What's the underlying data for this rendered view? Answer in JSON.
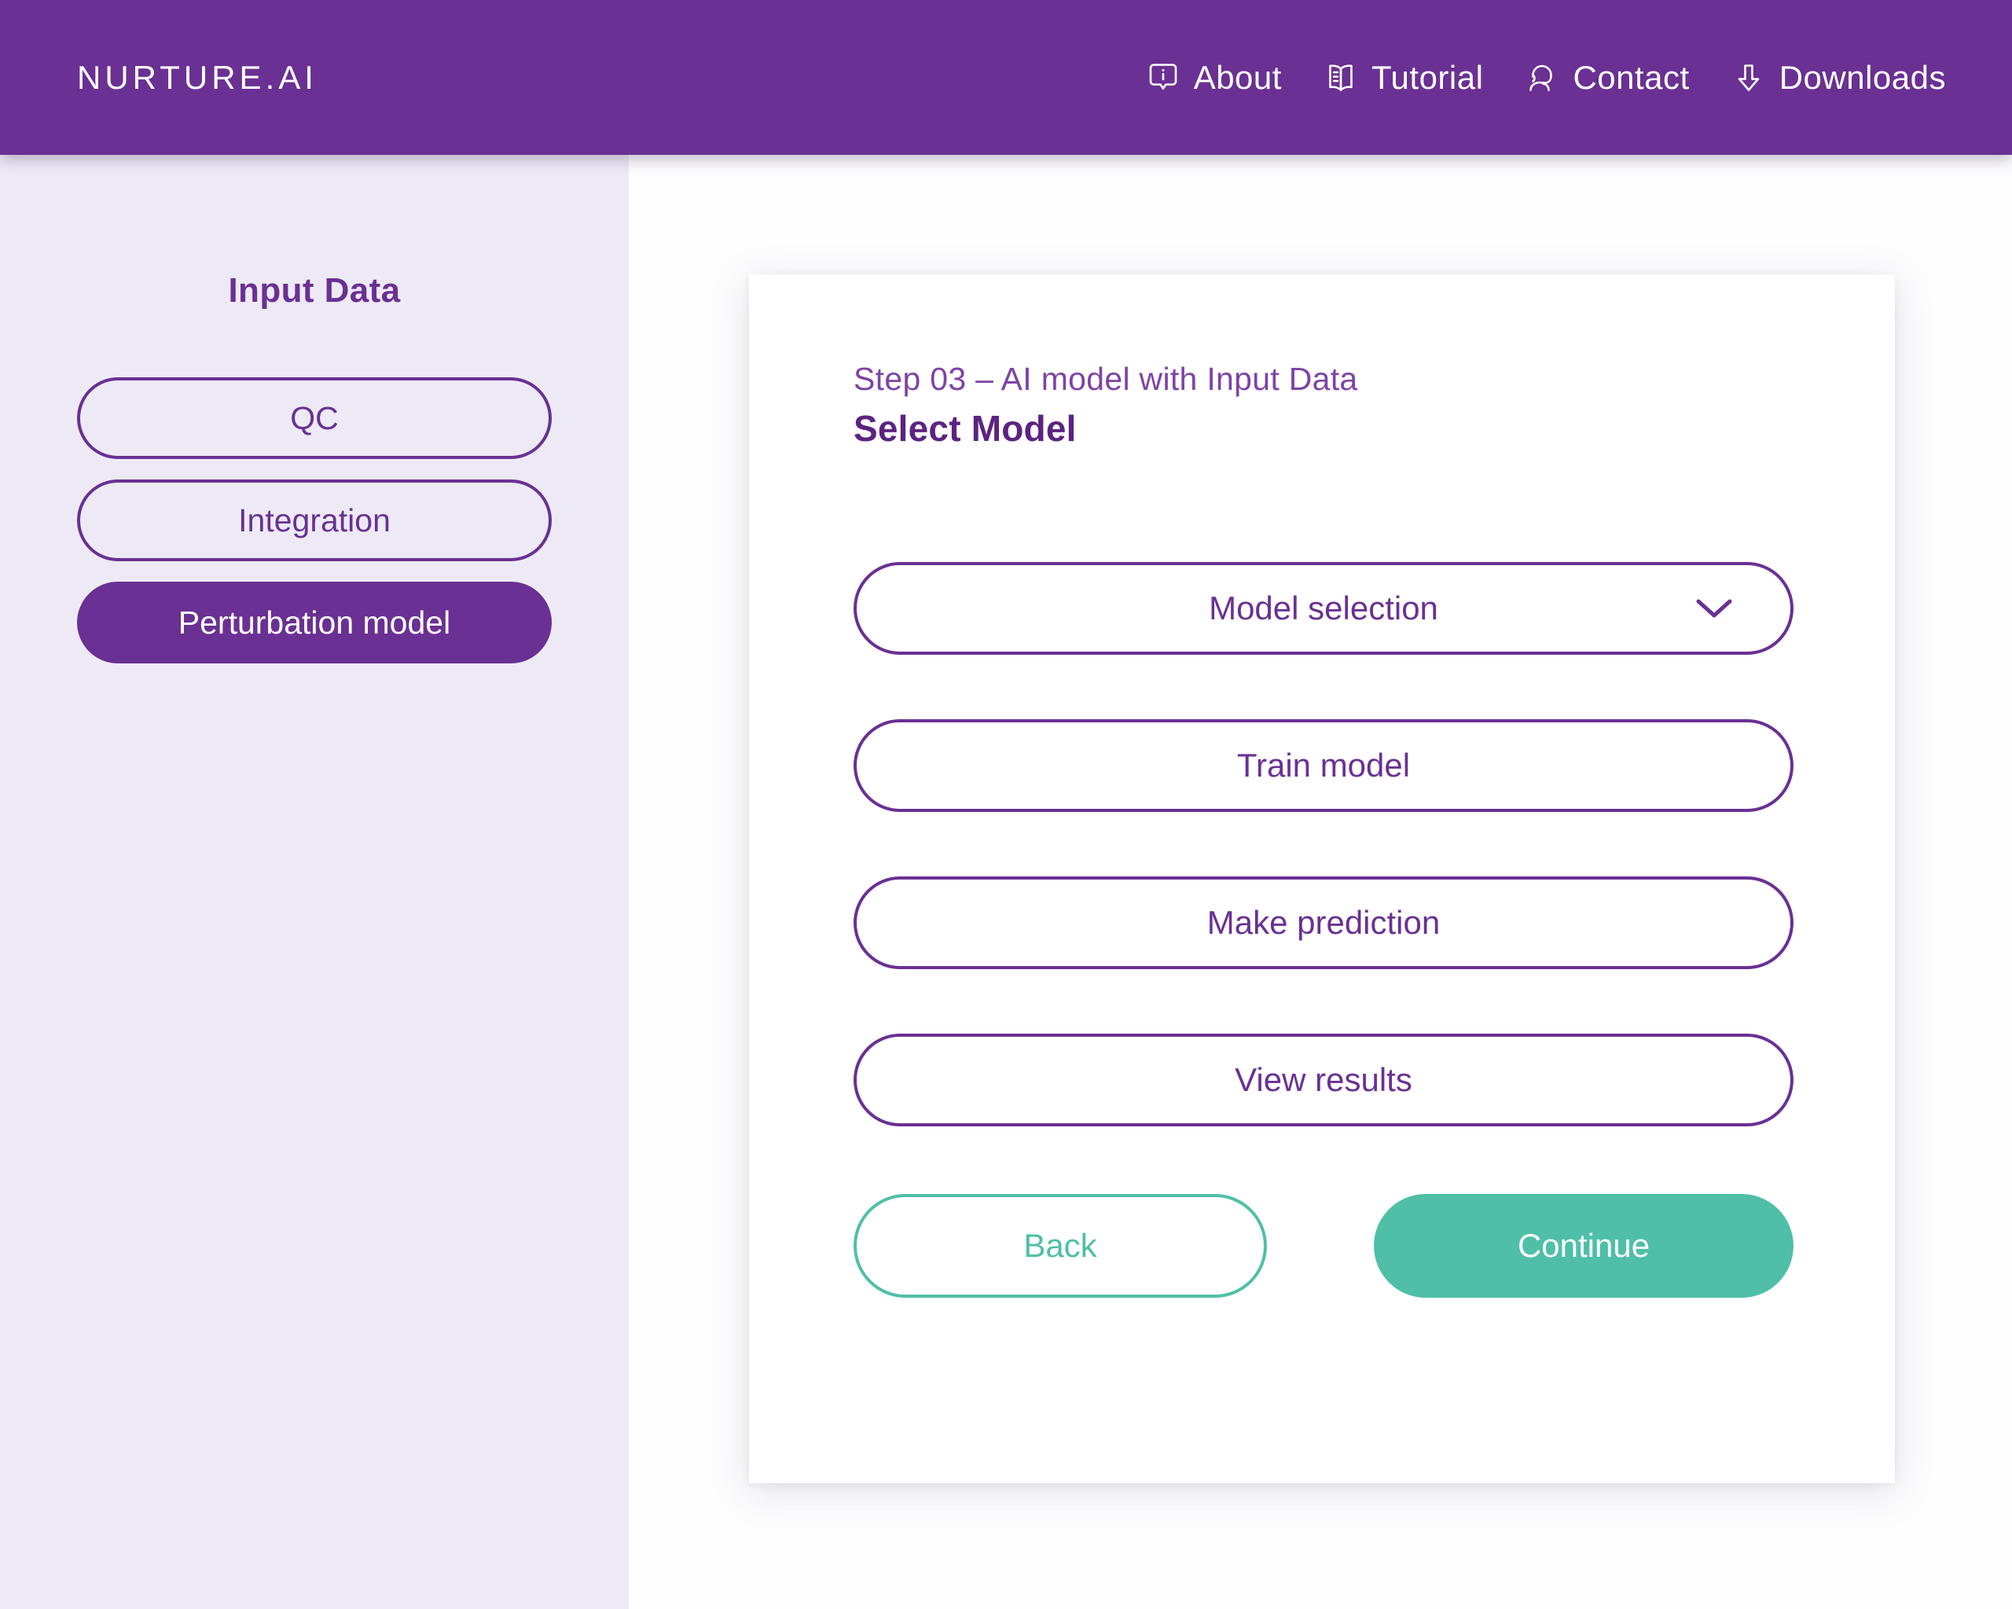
{
  "header": {
    "brand": "NURTURE.AI",
    "nav": [
      {
        "label": "About",
        "icon": "info-bubble-icon"
      },
      {
        "label": "Tutorial",
        "icon": "book-icon"
      },
      {
        "label": "Contact",
        "icon": "support-agent-icon"
      },
      {
        "label": "Downloads",
        "icon": "download-arrow-icon"
      }
    ]
  },
  "sidebar": {
    "title": "Input Data",
    "items": [
      {
        "label": "QC",
        "state": "inactive"
      },
      {
        "label": "Integration",
        "state": "inactive"
      },
      {
        "label": "Perturbation model",
        "state": "active"
      }
    ]
  },
  "main": {
    "card": {
      "step_label": "Step  03 – AI model with Input Data",
      "title": "Select Model",
      "options": [
        {
          "label": "Model selection",
          "icon": "chevron-down-icon",
          "has_chevron": true
        },
        {
          "label": "Train model",
          "icon": "",
          "has_chevron": false
        },
        {
          "label": "Make prediction",
          "icon": "",
          "has_chevron": false
        },
        {
          "label": "View results",
          "icon": "",
          "has_chevron": false
        }
      ],
      "actions": {
        "back_label": "Back",
        "continue_label": "Continue"
      }
    }
  },
  "colors": {
    "brand_purple": "#6A3093",
    "sidebar_bg": "#EDEAF6",
    "accent_teal": "#4FBFA8",
    "card_bg": "#FFFFFF",
    "step_label_purple": "#7E43A6"
  }
}
